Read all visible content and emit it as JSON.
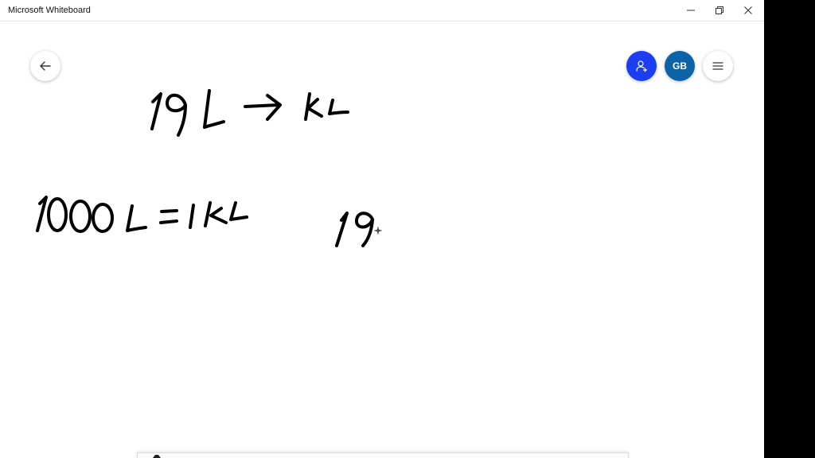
{
  "window": {
    "title": "Microsoft Whiteboard",
    "controls": [
      "minimize-icon",
      "restore-icon",
      "close-icon"
    ]
  },
  "header": {
    "back_icon": "arrow-left-icon",
    "share_icon": "add-person-icon",
    "avatar_initials": "GB",
    "menu_icon": "hamburger-menu-icon"
  },
  "colors": {
    "share_button": "#1a3ef0",
    "avatar_button": "#0d63a7",
    "ink": "#000000",
    "outer_background": "#000000"
  },
  "board": {
    "handwriting": [
      "19L → kL",
      "1000L = 1kL",
      "19"
    ]
  }
}
